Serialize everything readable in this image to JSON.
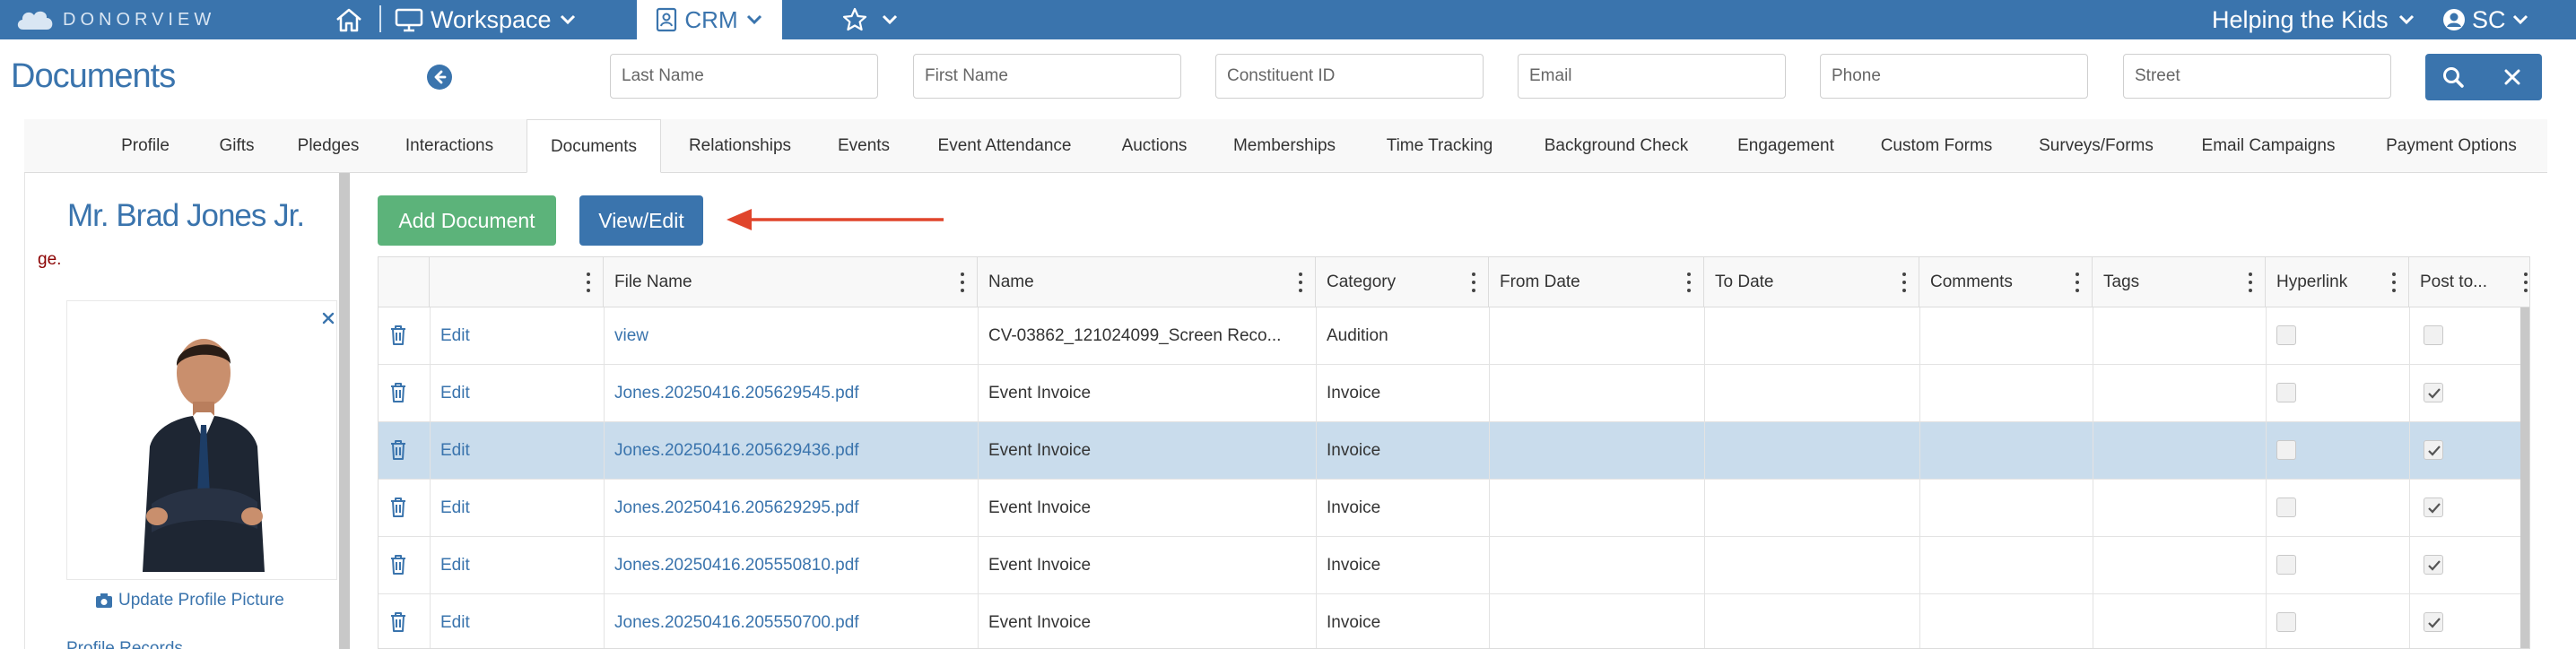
{
  "topbar": {
    "logo_text": "DONORVIEW",
    "workspace_label": "Workspace",
    "crm_label": "CRM",
    "org_name": "Helping the Kids",
    "user_initials": "SC"
  },
  "header": {
    "title": "Documents",
    "search": {
      "last_name_placeholder": "Last Name",
      "first_name_placeholder": "First Name",
      "constituent_id_placeholder": "Constituent ID",
      "email_placeholder": "Email",
      "phone_placeholder": "Phone",
      "street_placeholder": "Street"
    }
  },
  "tabs": [
    {
      "label": "Profile"
    },
    {
      "label": "Gifts"
    },
    {
      "label": "Pledges"
    },
    {
      "label": "Interactions"
    },
    {
      "label": "Documents"
    },
    {
      "label": "Relationships"
    },
    {
      "label": "Events"
    },
    {
      "label": "Event Attendance"
    },
    {
      "label": "Auctions"
    },
    {
      "label": "Memberships"
    },
    {
      "label": "Time Tracking"
    },
    {
      "label": "Background Check"
    },
    {
      "label": "Engagement"
    },
    {
      "label": "Custom Forms"
    },
    {
      "label": "Surveys/Forms"
    },
    {
      "label": "Email Campaigns"
    },
    {
      "label": "Payment Options"
    }
  ],
  "profile": {
    "name": "Mr. Brad Jones Jr.",
    "note": "ge.",
    "update_picture_label": "Update Profile Picture",
    "more_label": "Profile Records"
  },
  "actions": {
    "add_document": "Add Document",
    "view_edit": "View/Edit"
  },
  "grid": {
    "columns": [
      "",
      "File Name",
      "Name",
      "Category",
      "From Date",
      "To Date",
      "Comments",
      "Tags",
      "Hyperlink",
      "Post to..."
    ],
    "rows": [
      {
        "edit": "Edit",
        "file_name": "view",
        "name": "CV-03862_121024099_Screen Reco...",
        "category": "Audition",
        "from_date": "",
        "to_date": "",
        "comments": "",
        "tags": "",
        "hyperlink": false,
        "post_to": false
      },
      {
        "edit": "Edit",
        "file_name": "Jones.20250416.205629545.pdf",
        "name": "Event Invoice",
        "category": "Invoice",
        "from_date": "",
        "to_date": "",
        "comments": "",
        "tags": "",
        "hyperlink": false,
        "post_to": true
      },
      {
        "edit": "Edit",
        "file_name": "Jones.20250416.205629436.pdf",
        "name": "Event Invoice",
        "category": "Invoice",
        "from_date": "",
        "to_date": "",
        "comments": "",
        "tags": "",
        "hyperlink": false,
        "post_to": true
      },
      {
        "edit": "Edit",
        "file_name": "Jones.20250416.205629295.pdf",
        "name": "Event Invoice",
        "category": "Invoice",
        "from_date": "",
        "to_date": "",
        "comments": "",
        "tags": "",
        "hyperlink": false,
        "post_to": true
      },
      {
        "edit": "Edit",
        "file_name": "Jones.20250416.205550810.pdf",
        "name": "Event Invoice",
        "category": "Invoice",
        "from_date": "",
        "to_date": "",
        "comments": "",
        "tags": "",
        "hyperlink": false,
        "post_to": true
      },
      {
        "edit": "Edit",
        "file_name": "Jones.20250416.205550700.pdf",
        "name": "Event Invoice",
        "category": "Invoice",
        "from_date": "",
        "to_date": "",
        "comments": "",
        "tags": "",
        "hyperlink": false,
        "post_to": true
      }
    ],
    "selected_row": 2
  },
  "colors": {
    "brand_blue": "#3a74ad",
    "add_green": "#5cb37a",
    "annotation_arrow": "#e0452c",
    "selected_row": "#c9dcec"
  },
  "icons": [
    "home-icon",
    "monitor-icon",
    "contact-card-icon",
    "star-icon",
    "user-circle-icon",
    "back-arrow-icon",
    "search-icon",
    "close-icon",
    "trash-icon",
    "camera-icon",
    "kebab-menu-icon"
  ]
}
